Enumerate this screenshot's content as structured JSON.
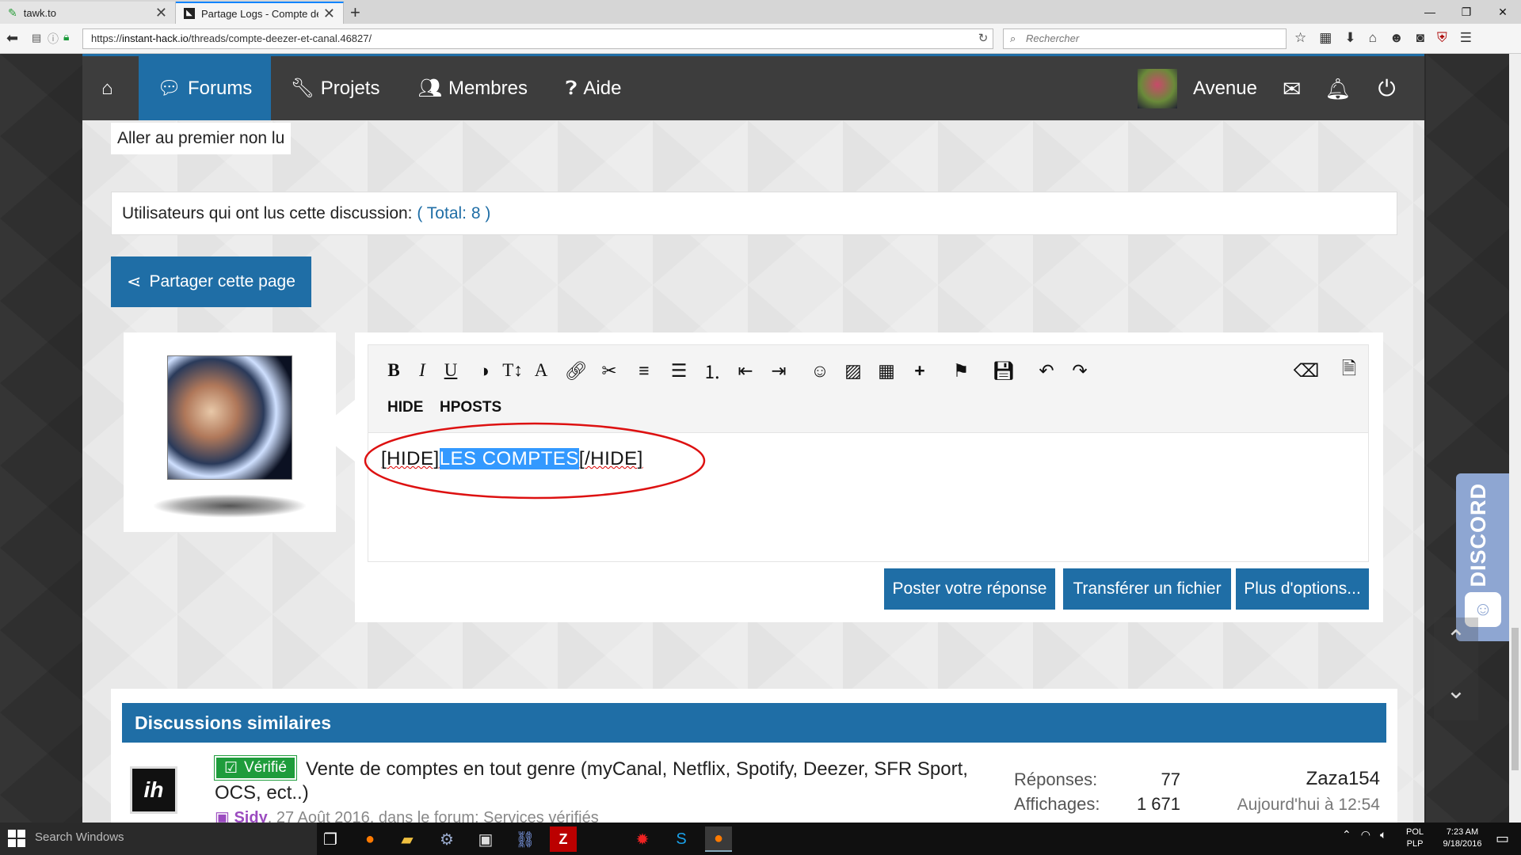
{
  "browser": {
    "tabs": [
      {
        "title": "tawk.to",
        "close": "✕"
      },
      {
        "title": "Partage Logs - Compte de...",
        "close": "✕"
      }
    ],
    "new_tab": "+",
    "url_prefix": "https://",
    "url_domain": "instant-hack.io",
    "url_path": "/threads/compte-deezer-et-canal.46827/",
    "search_placeholder": "Rechercher",
    "window_controls": [
      "—",
      "❐",
      "✕"
    ]
  },
  "site_nav": {
    "items": [
      {
        "icon": "home-icon",
        "label": ""
      },
      {
        "icon": "comments-icon",
        "label": "Forums"
      },
      {
        "icon": "wrench-icon",
        "label": "Projets"
      },
      {
        "icon": "users-icon",
        "label": "Membres"
      },
      {
        "icon": "question-icon",
        "label": "Aide"
      }
    ],
    "active": "Forums",
    "user_name": "Avenue"
  },
  "thread": {
    "first_unread": "Aller au premier non lu",
    "readers_label": "Utilisateurs qui ont lus cette discussion:",
    "readers_total": "( Total: 8 )",
    "share_label": "Partager cette page"
  },
  "editor": {
    "toolbar_words": [
      "HIDE",
      "HPOSTS"
    ],
    "text_before": "[HIDE]",
    "text_selected": "LES COMPTES",
    "text_after": "[/HIDE]",
    "buttons": {
      "post": "Poster votre réponse",
      "upload": "Transférer un fichier",
      "more": "Plus d'options..."
    }
  },
  "discord_badge": "DISCORD",
  "similar": {
    "heading": "Discussions similaires",
    "items": [
      {
        "badge": "Vérifié",
        "title_line1": "Vente de comptes en tout genre (myCanal, Netflix, Spotify, Deezer, SFR Sport,",
        "title_line2": "OCS, ect..)",
        "author": "Sidy",
        "meta": ", 27 Août 2016, dans le forum: Services vérifiés",
        "replies_label": "Réponses:",
        "replies": "77",
        "views_label": "Affichages:",
        "views": "1 671",
        "last_user": "Zaza154",
        "last_date": "Aujourd'hui à 12:54"
      }
    ]
  },
  "taskbar": {
    "search": "Search Windows",
    "lang_line1": "POL",
    "lang_line2": "PLP",
    "time": "7:23 AM",
    "date": "9/18/2016"
  },
  "colors": {
    "accent": "#1f6ea6",
    "verified": "#1e9c3b",
    "selection": "#3399ff",
    "annotation": "#dd1111",
    "discord": "#8ea6d2"
  }
}
